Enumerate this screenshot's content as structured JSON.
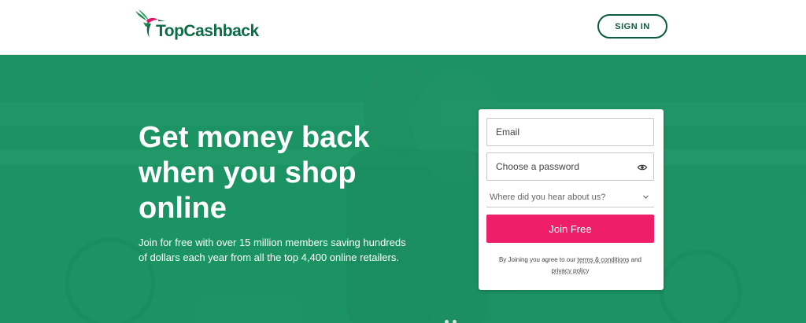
{
  "header": {
    "logo_text": "TopCashback",
    "signin_label": "SIGN IN"
  },
  "hero": {
    "headline": "Get money back when you shop online",
    "subtext": "Join for free with over 15 million members saving hundreds of dollars each year from all the top 4,400 online retailers."
  },
  "form": {
    "email_placeholder": "Email",
    "password_placeholder": "Choose a password",
    "referral_placeholder": "Where did you hear about us?",
    "join_label": "Join Free",
    "terms_prefix": "By Joining you agree to our",
    "terms_link": "terms & conditions",
    "terms_and": "and",
    "privacy_link": "privacy policy"
  },
  "colors": {
    "brand_green": "#0c6b44",
    "hero_green": "#1b9a6b",
    "join_pink": "#ee1f68"
  },
  "icons": {
    "logo": "hummingbird-icon",
    "password_toggle": "eye-icon",
    "select": "chevron-down-icon"
  }
}
